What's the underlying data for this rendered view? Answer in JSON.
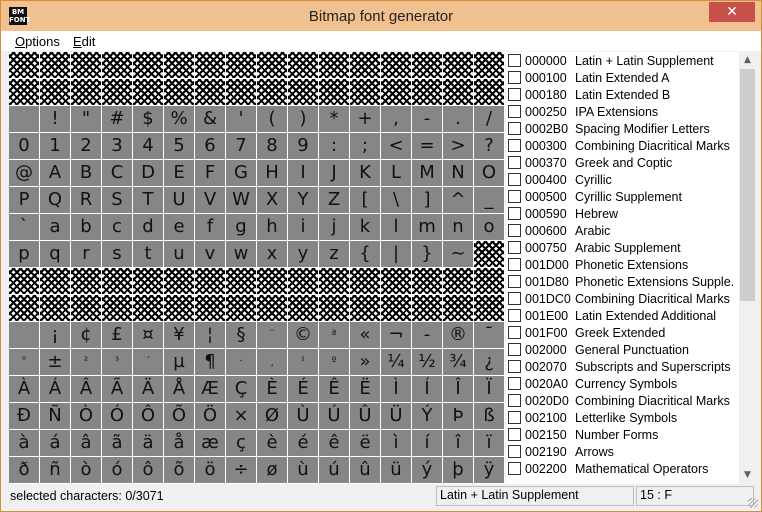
{
  "window": {
    "title": "Bitmap font generator",
    "icon_label": "BM FONT",
    "close_glyph": "✕"
  },
  "menu": {
    "options": "Options",
    "edit": "Edit"
  },
  "char_grid": {
    "cells": [
      "",
      "",
      "",
      "",
      "",
      "",
      "",
      "",
      "",
      "",
      "",
      "",
      "",
      "",
      "",
      "",
      "",
      "",
      "",
      "",
      "",
      "",
      "",
      "",
      "",
      "",
      "",
      "",
      "",
      "",
      "",
      "",
      " ",
      "!",
      "\"",
      "#",
      "$",
      "%",
      "&",
      "'",
      "(",
      ")",
      "*",
      "+",
      ",",
      "-",
      ".",
      "/",
      "0",
      "1",
      "2",
      "3",
      "4",
      "5",
      "6",
      "7",
      "8",
      "9",
      ":",
      ";",
      "<",
      "=",
      ">",
      "?",
      "@",
      "A",
      "B",
      "C",
      "D",
      "E",
      "F",
      "G",
      "H",
      "I",
      "J",
      "K",
      "L",
      "M",
      "N",
      "O",
      "P",
      "Q",
      "R",
      "S",
      "T",
      "U",
      "V",
      "W",
      "X",
      "Y",
      "Z",
      "[",
      "\\",
      "]",
      "^",
      "_",
      "`",
      "a",
      "b",
      "c",
      "d",
      "e",
      "f",
      "g",
      "h",
      "i",
      "j",
      "k",
      "l",
      "m",
      "n",
      "o",
      "p",
      "q",
      "r",
      "s",
      "t",
      "u",
      "v",
      "w",
      "x",
      "y",
      "z",
      "{",
      "|",
      "}",
      "~",
      "",
      "",
      "",
      "",
      "",
      "",
      "",
      "",
      "",
      "",
      "",
      "",
      "",
      "",
      "",
      "",
      "",
      "",
      "",
      "",
      "",
      "",
      "",
      "",
      "",
      "",
      "",
      "",
      "",
      "",
      "",
      "",
      "",
      " ",
      "¡",
      "¢",
      "£",
      "¤",
      "¥",
      "¦",
      "§",
      "¨",
      "©",
      "ª",
      "«",
      "¬",
      "-",
      "®",
      "¯",
      "°",
      "±",
      "²",
      "³",
      "´",
      "µ",
      "¶",
      "·",
      "¸",
      "¹",
      "º",
      "»",
      "¼",
      "½",
      "¾",
      "¿",
      "À",
      "Á",
      "Â",
      "Ã",
      "Ä",
      "Å",
      "Æ",
      "Ç",
      "È",
      "É",
      "Ê",
      "Ë",
      "Ì",
      "Í",
      "Î",
      "Ï",
      "Ð",
      "Ñ",
      "Ò",
      "Ó",
      "Ô",
      "Õ",
      "Ö",
      "×",
      "Ø",
      "Ù",
      "Ú",
      "Û",
      "Ü",
      "Ý",
      "Þ",
      "ß",
      "à",
      "á",
      "â",
      "ã",
      "ä",
      "å",
      "æ",
      "ç",
      "è",
      "é",
      "ê",
      "ë",
      "ì",
      "í",
      "î",
      "ï",
      "ð",
      "ñ",
      "ò",
      "ó",
      "ô",
      "õ",
      "ö",
      "÷",
      "ø",
      "ù",
      "ú",
      "û",
      "ü",
      "ý",
      "þ",
      "ÿ"
    ],
    "absent_cells": [
      0,
      1,
      2,
      3,
      4,
      5,
      6,
      7,
      8,
      9,
      10,
      11,
      12,
      13,
      14,
      15,
      16,
      17,
      18,
      19,
      20,
      21,
      22,
      23,
      24,
      25,
      26,
      27,
      28,
      29,
      30,
      31,
      127,
      128,
      129,
      130,
      131,
      132,
      133,
      134,
      135,
      136,
      137,
      138,
      139,
      140,
      141,
      142,
      143,
      144,
      145,
      146,
      147,
      148,
      149,
      150,
      151,
      152,
      153,
      154,
      155,
      156,
      157,
      158,
      159
    ]
  },
  "ranges": [
    {
      "code": "000000",
      "name": "Latin + Latin Supplement"
    },
    {
      "code": "000100",
      "name": "Latin Extended A"
    },
    {
      "code": "000180",
      "name": "Latin Extended B"
    },
    {
      "code": "000250",
      "name": "IPA Extensions"
    },
    {
      "code": "0002B0",
      "name": "Spacing Modifier Letters"
    },
    {
      "code": "000300",
      "name": "Combining Diacritical Marks"
    },
    {
      "code": "000370",
      "name": "Greek and Coptic"
    },
    {
      "code": "000400",
      "name": "Cyrillic"
    },
    {
      "code": "000500",
      "name": "Cyrillic Supplement"
    },
    {
      "code": "000590",
      "name": "Hebrew"
    },
    {
      "code": "000600",
      "name": "Arabic"
    },
    {
      "code": "000750",
      "name": "Arabic Supplement"
    },
    {
      "code": "001D00",
      "name": "Phonetic Extensions"
    },
    {
      "code": "001D80",
      "name": "Phonetic Extensions Supple."
    },
    {
      "code": "001DC0",
      "name": "Combining Diacritical Marks"
    },
    {
      "code": "001E00",
      "name": "Latin Extended Additional"
    },
    {
      "code": "001F00",
      "name": "Greek Extended"
    },
    {
      "code": "002000",
      "name": "General Punctuation"
    },
    {
      "code": "002070",
      "name": "Subscripts and Superscripts"
    },
    {
      "code": "0020A0",
      "name": "Currency Symbols"
    },
    {
      "code": "0020D0",
      "name": "Combining Diacritical Marks"
    },
    {
      "code": "002100",
      "name": "Letterlike Symbols"
    },
    {
      "code": "002150",
      "name": "Number Forms"
    },
    {
      "code": "002190",
      "name": "Arrows"
    },
    {
      "code": "002200",
      "name": "Mathematical Operators"
    }
  ],
  "scrollbar": {
    "up_glyph": "▲",
    "down_glyph": "▼",
    "position": 0.0
  },
  "status": {
    "selected": "selected characters: 0/3071",
    "range": "Latin + Latin Supplement",
    "position": "15 : F"
  }
}
